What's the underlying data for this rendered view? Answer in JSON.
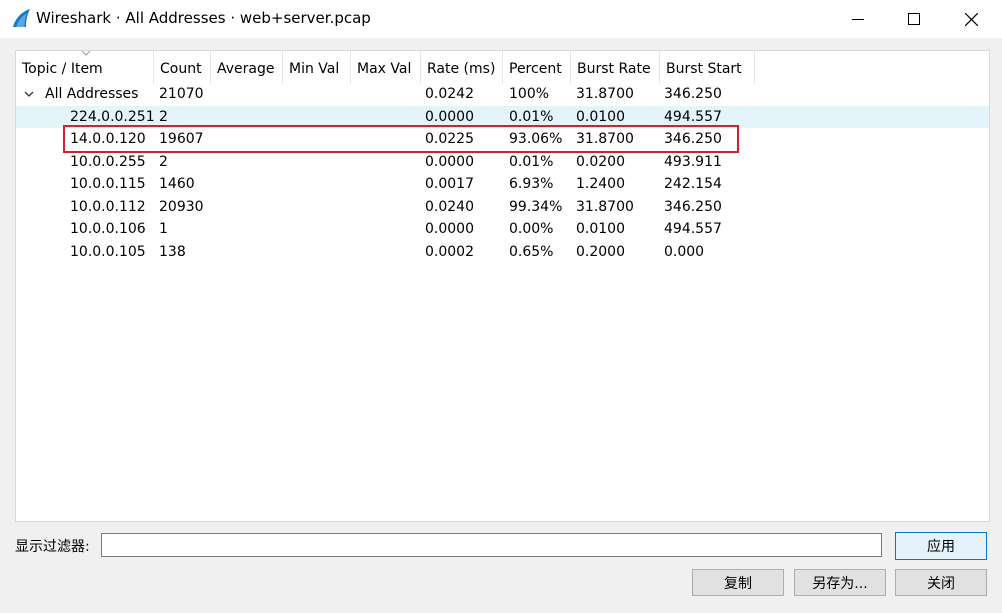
{
  "window": {
    "title": "Wireshark · All Addresses · web+server.pcap"
  },
  "tree": {
    "columns": [
      "Topic / Item",
      "Count",
      "Average",
      "Min Val",
      "Max Val",
      "Rate (ms)",
      "Percent",
      "Burst Rate",
      "Burst Start"
    ],
    "rows": [
      {
        "item": "All Addresses",
        "count": "21070",
        "average": "",
        "min_val": "",
        "max_val": "",
        "rate": "0.0242",
        "percent": "100%",
        "burst_rate": "31.8700",
        "burst_start": "346.250"
      },
      {
        "item": "224.0.0.251",
        "count": "2",
        "average": "",
        "min_val": "",
        "max_val": "",
        "rate": "0.0000",
        "percent": "0.01%",
        "burst_rate": "0.0100",
        "burst_start": "494.557"
      },
      {
        "item": "14.0.0.120",
        "count": "19607",
        "average": "",
        "min_val": "",
        "max_val": "",
        "rate": "0.0225",
        "percent": "93.06%",
        "burst_rate": "31.8700",
        "burst_start": "346.250"
      },
      {
        "item": "10.0.0.255",
        "count": "2",
        "average": "",
        "min_val": "",
        "max_val": "",
        "rate": "0.0000",
        "percent": "0.01%",
        "burst_rate": "0.0200",
        "burst_start": "493.911"
      },
      {
        "item": "10.0.0.115",
        "count": "1460",
        "average": "",
        "min_val": "",
        "max_val": "",
        "rate": "0.0017",
        "percent": "6.93%",
        "burst_rate": "1.2400",
        "burst_start": "242.154"
      },
      {
        "item": "10.0.0.112",
        "count": "20930",
        "average": "",
        "min_val": "",
        "max_val": "",
        "rate": "0.0240",
        "percent": "99.34%",
        "burst_rate": "31.8700",
        "burst_start": "346.250"
      },
      {
        "item": "10.0.0.106",
        "count": "1",
        "average": "",
        "min_val": "",
        "max_val": "",
        "rate": "0.0000",
        "percent": "0.00%",
        "burst_rate": "0.0100",
        "burst_start": "494.557"
      },
      {
        "item": "10.0.0.105",
        "count": "138",
        "average": "",
        "min_val": "",
        "max_val": "",
        "rate": "0.0002",
        "percent": "0.65%",
        "burst_rate": "0.2000",
        "burst_start": "0.000"
      }
    ]
  },
  "filter": {
    "label": "显示过滤器:",
    "value": "",
    "apply_label": "应用"
  },
  "buttons": {
    "copy_label": "复制",
    "save_as_label": "另存为...",
    "close_label": "关闭"
  },
  "colors": {
    "selection": "#e5f3fb",
    "highlight_box": "#d6212b",
    "wireshark_fin": "#1679c5"
  }
}
